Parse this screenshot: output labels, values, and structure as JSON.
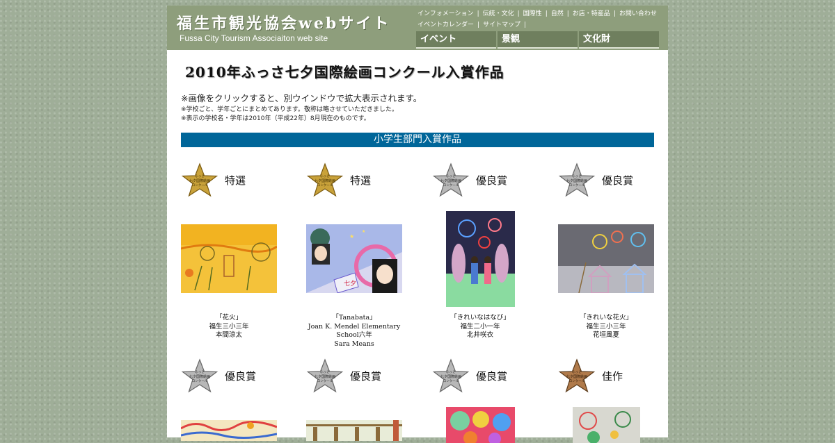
{
  "header": {
    "logo_jp": "福生市観光協会webサイト",
    "logo_en": "Fussa City Tourism Associaiton web site",
    "util_links": [
      "インフォメーション",
      "伝統・文化",
      "国際性",
      "自然",
      "お店・特産品",
      "お問い合わせ",
      "イベントカレンダー",
      "サイトマップ"
    ],
    "nav": [
      "イベント",
      "景観",
      "文化財"
    ]
  },
  "page": {
    "title": "2010年ふっさ七夕国際絵画コンクール入賞作品",
    "note_main": "※画像をクリックすると、別ウインドウで拡大表示されます。",
    "note_sub1": "※学校ごと、学年ごとにまとめてあります。敬称は略させていただきました。",
    "note_sub2": "※表示の学校名・学年は2010年（平成22年）8月現在のものです。",
    "section": "小学生部門入賞作品"
  },
  "colors": {
    "gold": "#c9a23a",
    "silver": "#b8b8b8",
    "bronze": "#b07a4a",
    "section_bar": "#006699",
    "header": "#8e9e7c"
  },
  "entries_row1": [
    {
      "award": "特選",
      "medal": "gold",
      "caption": [
        "「花火」",
        "福生三小三年",
        "本間涼太"
      ]
    },
    {
      "award": "特選",
      "medal": "gold",
      "caption": [
        "「Tanabata」",
        "Joan K. Mendel Elementary",
        "School六年",
        "Sara Means"
      ]
    },
    {
      "award": "優良賞",
      "medal": "silver",
      "caption": [
        "「きれいなはなび」",
        "福生二小一年",
        "北井咲衣"
      ]
    },
    {
      "award": "優良賞",
      "medal": "silver",
      "caption": [
        "「きれいな花火」",
        "福生三小三年",
        "花垣風夏"
      ]
    }
  ],
  "entries_row2": [
    {
      "award": "優良賞",
      "medal": "silver"
    },
    {
      "award": "優良賞",
      "medal": "silver"
    },
    {
      "award": "優良賞",
      "medal": "silver"
    },
    {
      "award": "佳作",
      "medal": "bronze"
    }
  ]
}
